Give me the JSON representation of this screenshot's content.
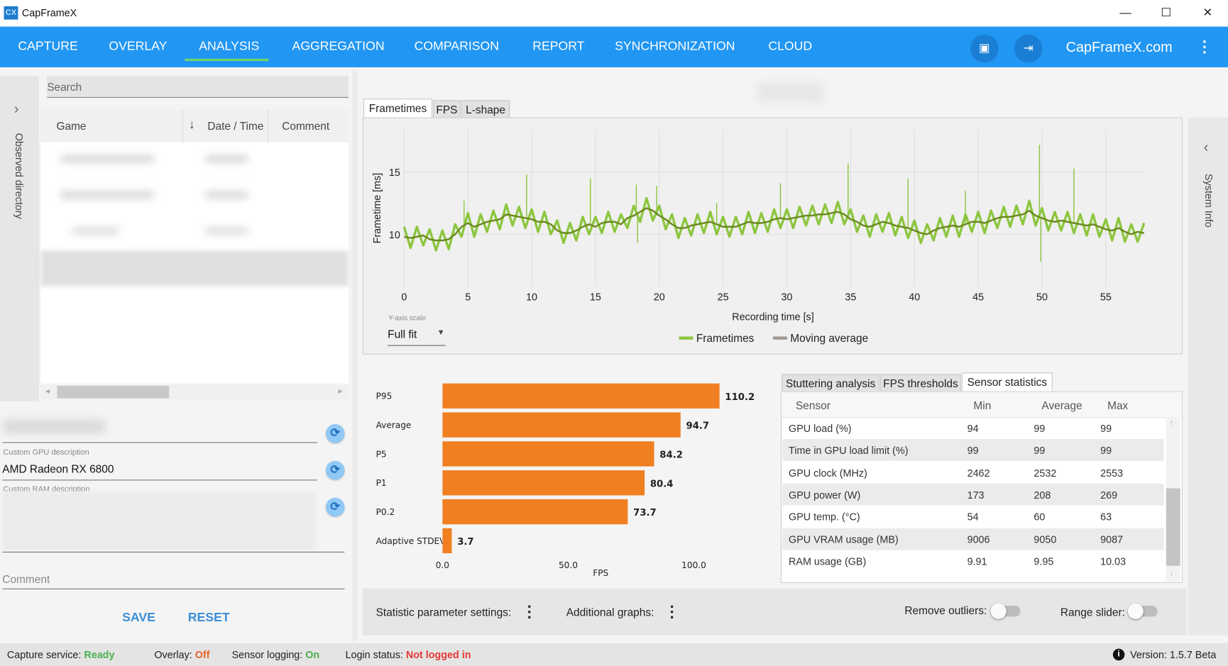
{
  "window": {
    "title": "CapFrameX",
    "icon_text": "CX",
    "controls": {
      "minimize": "—",
      "maximize": "☐",
      "close": "✕"
    }
  },
  "nav": {
    "items": [
      {
        "label": "CAPTURE"
      },
      {
        "label": "OVERLAY"
      },
      {
        "label": "ANALYSIS",
        "active": true
      },
      {
        "label": "AGGREGATION"
      },
      {
        "label": "COMPARISON"
      },
      {
        "label": "REPORT"
      },
      {
        "label": "SYNCHRONIZATION"
      },
      {
        "label": "CLOUD"
      }
    ],
    "site_link": "CapFrameX.com",
    "icons": [
      "screenshot-icon",
      "login-icon",
      "more-vert-icon"
    ],
    "accent": "#2196f3",
    "active_underline": "#6fd36f"
  },
  "left": {
    "observed_directory_label": "Observed directory",
    "search_placeholder": "Search",
    "columns": {
      "game": "Game",
      "date_time": "Date / Time",
      "comment": "Comment"
    },
    "custom_gpu_label": "Custom GPU description",
    "custom_gpu_value": "AMD Radeon RX 6800",
    "custom_ram_label": "Custom RAM description",
    "comment_placeholder": "Comment",
    "save": "SAVE",
    "reset": "RESET"
  },
  "chart_tabs": [
    {
      "label": "Frametimes",
      "selected": true
    },
    {
      "label": "FPS"
    },
    {
      "label": "L-shape"
    }
  ],
  "chart_data": [
    {
      "type": "line",
      "xlabel": "Recording time [s]",
      "ylabel": "Frametime [ms]",
      "x_ticks": [
        0,
        5,
        10,
        15,
        20,
        25,
        30,
        35,
        40,
        45,
        50,
        55
      ],
      "y_ticks": [
        10,
        15
      ],
      "xlim": [
        0,
        58
      ],
      "ylim": [
        5.8,
        18.4
      ],
      "grid": true,
      "legend_placement": "bottom",
      "series": [
        {
          "name": "Frametimes",
          "color": "#8cc63f"
        },
        {
          "name": "Moving average",
          "color": "#a09a94",
          "line_color": "#6b8a1e"
        }
      ],
      "time_s": [
        0,
        0.5,
        1,
        1.5,
        2,
        2.5,
        3,
        3.5,
        4,
        4.5,
        5,
        5.5,
        6,
        6.5,
        7,
        7.5,
        8,
        8.5,
        9,
        9.5,
        10,
        10.5,
        11,
        11.5,
        12,
        12.5,
        13,
        13.5,
        14,
        14.5,
        15,
        15.5,
        16,
        16.5,
        17,
        17.5,
        18,
        18.5,
        19,
        19.5,
        20,
        20.5,
        21,
        21.5,
        22,
        22.5,
        23,
        23.5,
        24,
        24.5,
        25,
        25.5,
        26,
        26.5,
        27,
        27.5,
        28,
        28.5,
        29,
        29.5,
        30,
        30.5,
        31,
        31.5,
        32,
        32.5,
        33,
        33.5,
        34,
        34.5,
        35,
        35.5,
        36,
        36.5,
        37,
        37.5,
        38,
        38.5,
        39,
        39.5,
        40,
        40.5,
        41,
        41.5,
        42,
        42.5,
        43,
        43.5,
        44,
        44.5,
        45,
        45.5,
        46,
        46.5,
        47,
        47.5,
        48,
        48.5,
        49,
        49.5,
        50,
        50.5,
        51,
        51.5,
        52,
        52.5,
        53,
        53.5,
        54,
        54.5,
        55,
        55.5,
        56,
        56.5,
        57,
        57.5,
        58
      ],
      "frametime_ms": [
        10.6,
        8.9,
        10.6,
        9.1,
        10.4,
        8.7,
        10.3,
        8.8,
        10.8,
        9.8,
        11.7,
        9.8,
        11.6,
        10.2,
        11.9,
        10.4,
        12.4,
        10.7,
        12.2,
        10.5,
        12.0,
        10.2,
        11.8,
        10.0,
        11.1,
        9.3,
        10.9,
        9.5,
        11.4,
        10.0,
        11.4,
        10.1,
        11.8,
        10.2,
        11.6,
        10.5,
        12.3,
        11.0,
        12.9,
        11.1,
        12.3,
        10.4,
        11.6,
        9.7,
        11.3,
        9.9,
        11.6,
        10.1,
        11.8,
        10.0,
        11.4,
        9.8,
        11.4,
        10.0,
        11.8,
        10.1,
        11.7,
        10.2,
        12.0,
        10.5,
        12.0,
        10.5,
        12.2,
        10.7,
        12.3,
        10.8,
        12.4,
        10.9,
        12.6,
        10.8,
        12.0,
        10.2,
        11.5,
        9.8,
        11.6,
        10.2,
        11.7,
        9.9,
        11.4,
        9.7,
        11.1,
        9.3,
        10.8,
        9.5,
        11.3,
        9.8,
        11.5,
        9.8,
        11.6,
        10.2,
        11.8,
        10.1,
        11.9,
        10.5,
        12.2,
        10.6,
        12.3,
        10.8,
        12.7,
        10.7,
        12.1,
        10.3,
        11.8,
        10.3,
        11.8,
        10.1,
        11.6,
        9.9,
        11.6,
        9.8,
        11.2,
        9.5,
        11.3,
        9.4,
        10.8,
        9.4,
        10.9
      ],
      "moving_average_ms": [
        9.8,
        9.7,
        9.8,
        9.9,
        9.6,
        9.5,
        9.5,
        9.6,
        10.0,
        10.6,
        10.9,
        10.6,
        10.8,
        11.0,
        11.1,
        11.2,
        11.6,
        11.5,
        11.4,
        11.3,
        11.2,
        11.0,
        11.0,
        10.8,
        10.3,
        10.1,
        10.1,
        10.3,
        10.6,
        10.8,
        10.6,
        10.9,
        11.0,
        11.0,
        10.8,
        11.3,
        11.5,
        11.8,
        12.1,
        11.9,
        11.5,
        11.2,
        10.8,
        10.5,
        10.5,
        10.7,
        10.8,
        10.9,
        11.0,
        10.8,
        10.6,
        10.6,
        10.6,
        10.8,
        11.0,
        10.9,
        10.9,
        11.0,
        11.2,
        11.3,
        11.2,
        11.3,
        11.4,
        11.5,
        11.5,
        11.6,
        11.6,
        11.7,
        11.8,
        11.6,
        11.2,
        11.0,
        10.7,
        10.6,
        10.8,
        11.0,
        10.9,
        10.7,
        10.6,
        10.5,
        10.3,
        10.1,
        10.0,
        10.3,
        10.5,
        10.6,
        10.7,
        10.6,
        10.8,
        11.0,
        11.0,
        10.9,
        11.1,
        11.3,
        11.4,
        11.4,
        11.5,
        11.6,
        11.9,
        11.5,
        11.3,
        11.1,
        11.0,
        11.1,
        11.0,
        10.9,
        10.8,
        10.7,
        10.8,
        10.6,
        10.4,
        10.3,
        10.5,
        10.2,
        10.0,
        10.2,
        10.1
      ],
      "spikes": [
        [
          4.7,
          12.7
        ],
        [
          9.6,
          14.8
        ],
        [
          14.6,
          14.5
        ],
        [
          18.2,
          14.0
        ],
        [
          18.3,
          9.3
        ],
        [
          19.8,
          13.9
        ],
        [
          24.5,
          12.5
        ],
        [
          29.5,
          14.1
        ],
        [
          34.8,
          15.7
        ],
        [
          39.5,
          14.5
        ],
        [
          44.0,
          13.5
        ],
        [
          49.8,
          17.2
        ],
        [
          49.9,
          7.8
        ],
        [
          52.5,
          15.3
        ]
      ]
    },
    {
      "type": "bar",
      "orientation": "horizontal",
      "xlabel": "FPS",
      "x_ticks": [
        "0.0",
        "50.0",
        "100.0"
      ],
      "xlim": [
        0,
        110.2
      ],
      "color": "#f07f22",
      "categories": [
        "P95",
        "Average",
        "P5",
        "P1",
        "P0.2",
        "Adaptive STDEV"
      ],
      "values": [
        110.2,
        94.7,
        84.2,
        80.4,
        73.7,
        3.7
      ],
      "labels": [
        "110.2",
        "94.7",
        "84.2",
        "80.4",
        "73.7",
        "3.7"
      ]
    }
  ],
  "y_axis_scale": {
    "label": "Y-axis scale",
    "value": "Full fit"
  },
  "sensor_tabs": [
    {
      "label": "Stuttering analysis"
    },
    {
      "label": "FPS thresholds"
    },
    {
      "label": "Sensor statistics",
      "selected": true
    }
  ],
  "sensor_table": {
    "headers": [
      "Sensor",
      "Min",
      "Average",
      "Max"
    ],
    "rows": [
      [
        "GPU load (%)",
        "94",
        "99",
        "99"
      ],
      [
        "Time in GPU load limit (%)",
        "99",
        "99",
        "99"
      ],
      [
        "GPU clock (MHz)",
        "2462",
        "2532",
        "2553"
      ],
      [
        "GPU power (W)",
        "173",
        "208",
        "269"
      ],
      [
        "GPU temp. (°C)",
        "54",
        "60",
        "63"
      ],
      [
        "GPU VRAM usage (MB)",
        "9006",
        "9050",
        "9087"
      ],
      [
        "RAM usage (GB)",
        "9.91",
        "9.95",
        "10.03"
      ]
    ]
  },
  "settings": {
    "statistic_parameter": "Statistic parameter settings:",
    "additional_graphs": "Additional graphs:",
    "remove_outliers": "Remove outliers:",
    "remove_outliers_on": false,
    "range_slider": "Range slider:",
    "range_slider_on": false
  },
  "right": {
    "system_info_label": "System Info"
  },
  "status": {
    "capture_label": "Capture service:",
    "capture_value": "Ready",
    "capture_color": "#4caf50",
    "overlay_label": "Overlay:",
    "overlay_value": "Off",
    "overlay_color": "#e8622c",
    "sensor_label": "Sensor logging:",
    "sensor_value": "On",
    "sensor_color": "#4caf50",
    "login_label": "Login status:",
    "login_value": "Not logged in",
    "login_color": "#e53935",
    "version": "Version: 1.5.7 Beta"
  }
}
